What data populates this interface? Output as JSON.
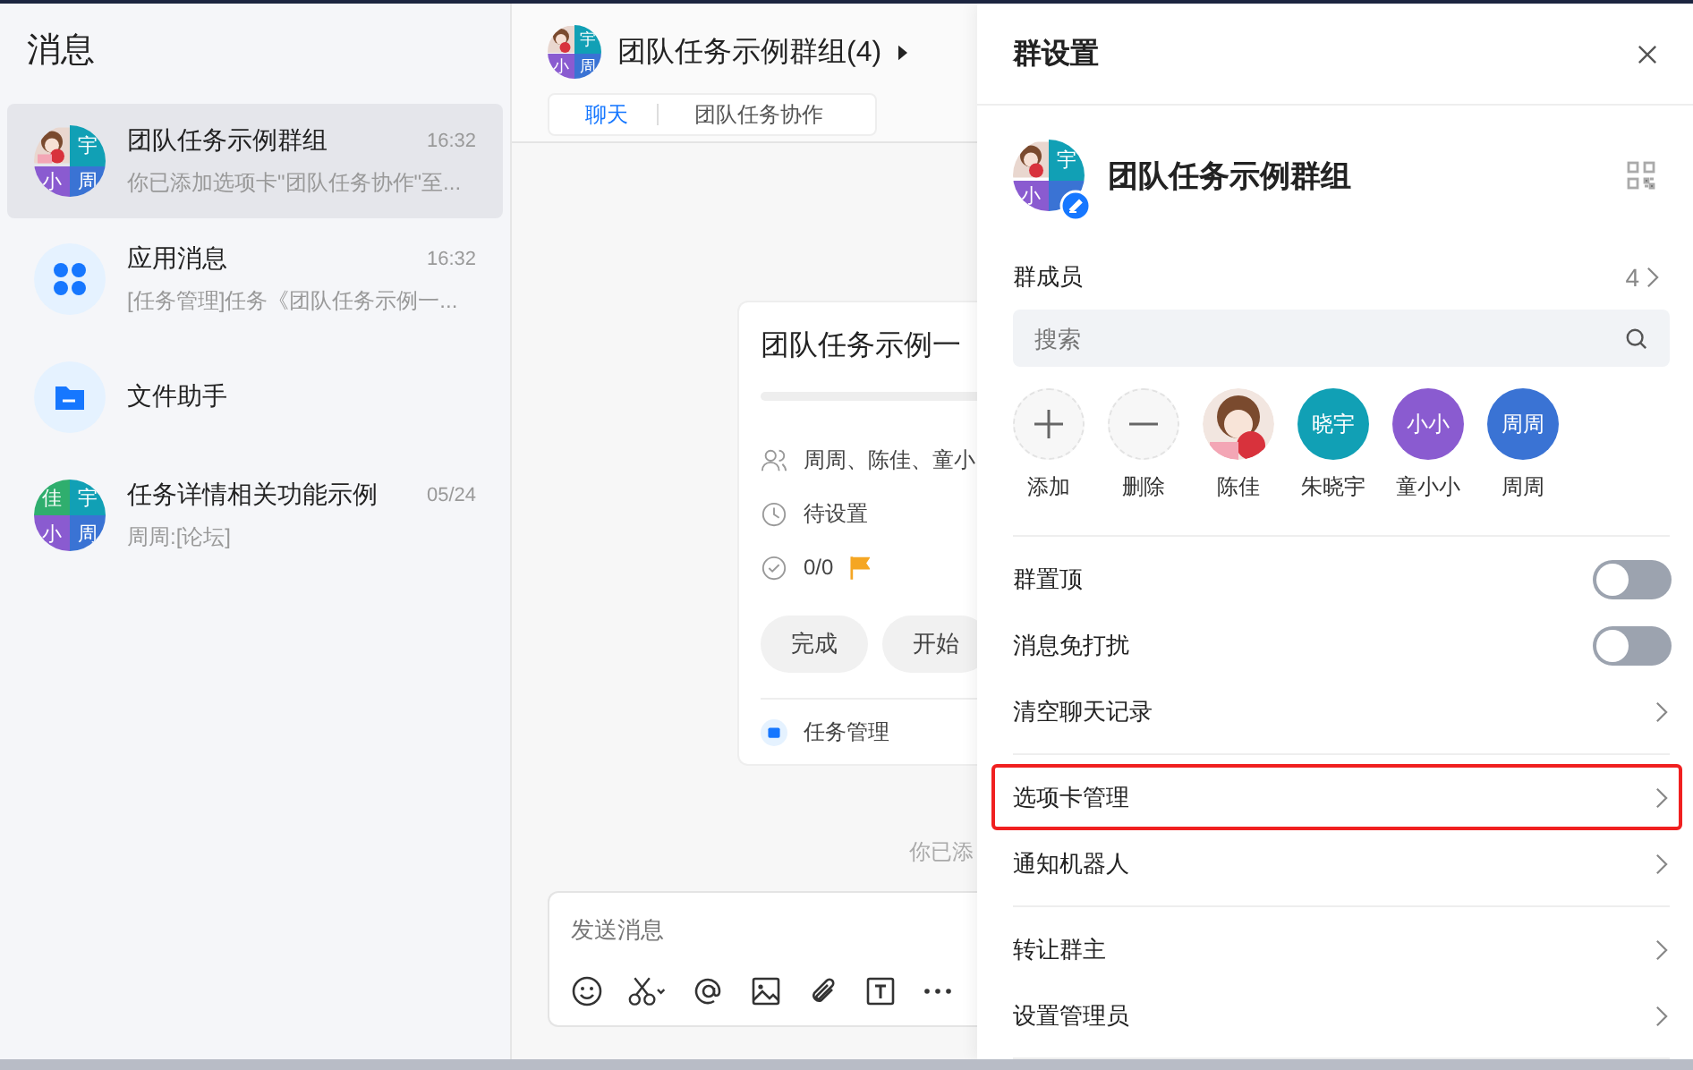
{
  "sidebar": {
    "title": "消息",
    "conversations": [
      {
        "kind": "group",
        "name": "团队任务示例群组",
        "time": "16:32",
        "preview": "你已添加选项卡\"团队任务协作\"至...",
        "selected": true,
        "cells": [
          {
            "kind": "picture"
          },
          {
            "text": "宇",
            "color": "#11a0b5"
          },
          {
            "text": "小",
            "color": "#8a5bd0"
          },
          {
            "text": "周",
            "color": "#3a73d4"
          }
        ]
      },
      {
        "kind": "apps",
        "name": "应用消息",
        "time": "16:32",
        "preview": "[任务管理]任务《团队任务示例一...",
        "selected": false
      },
      {
        "kind": "files",
        "name": "文件助手",
        "selected": false
      },
      {
        "kind": "group",
        "name": "任务详情相关功能示例",
        "time": "05/24",
        "preview": "周周:[论坛]",
        "selected": false,
        "cells": [
          {
            "text": "佳",
            "color": "#2fae6e"
          },
          {
            "text": "宇",
            "color": "#11a0b5"
          },
          {
            "text": "小",
            "color": "#8a5bd0"
          },
          {
            "text": "周",
            "color": "#3a73d4"
          }
        ]
      }
    ]
  },
  "chat": {
    "title": "团队任务示例群组(4)",
    "cells": [
      {
        "kind": "picture"
      },
      {
        "text": "宇",
        "color": "#11a0b5"
      },
      {
        "text": "小",
        "color": "#8a5bd0"
      },
      {
        "text": "周",
        "color": "#3a73d4"
      }
    ],
    "tabs": [
      {
        "label": "聊天",
        "selected": true
      },
      {
        "label": "团队任务协作",
        "selected": false
      }
    ],
    "card": {
      "title": "团队任务示例一",
      "rows": [
        {
          "kind": "members",
          "text": "周周、陈佳、童小"
        },
        {
          "kind": "due",
          "text": "待设置"
        },
        {
          "kind": "progress",
          "text": "0/0"
        }
      ],
      "buttons": [
        "完成",
        "开始"
      ],
      "app": "任务管理"
    },
    "system_message": "你已添",
    "input": {
      "placeholder": "发送消息"
    }
  },
  "panel": {
    "title": "群设置",
    "group_name": "团队任务示例群组",
    "cells": [
      {
        "kind": "picture"
      },
      {
        "text": "宇",
        "color": "#11a0b5"
      },
      {
        "text": "小",
        "color": "#8a5bd0"
      },
      {
        "color": "#3a73d4"
      }
    ],
    "members_label": "群成员",
    "members_count": "4",
    "search_placeholder": "搜索",
    "members": [
      {
        "kind": "add",
        "label": "添加"
      },
      {
        "kind": "remove",
        "label": "删除"
      },
      {
        "label": "陈佳"
      },
      {
        "kind": "initials",
        "text": "晓宇",
        "color": "#11a0b5",
        "label": "朱晓宇"
      },
      {
        "kind": "initials",
        "text": "小小",
        "color": "#8a5bd0",
        "label": "童小小"
      },
      {
        "kind": "initials",
        "text": "周周",
        "color": "#3a73d4",
        "label": "周周"
      }
    ],
    "sections": [
      [
        {
          "kind": "toggle",
          "label": "群置顶",
          "on": false
        },
        {
          "kind": "toggle",
          "label": "消息免打扰",
          "on": false
        },
        {
          "kind": "link",
          "label": "清空聊天记录",
          "highlighted": false
        }
      ],
      [
        {
          "kind": "link",
          "label": "选项卡管理",
          "highlighted": true
        },
        {
          "kind": "link",
          "label": "通知机器人",
          "highlighted": false
        }
      ],
      [
        {
          "kind": "link",
          "label": "转让群主",
          "highlighted": false
        },
        {
          "kind": "link",
          "label": "设置管理员",
          "highlighted": false
        }
      ]
    ]
  }
}
